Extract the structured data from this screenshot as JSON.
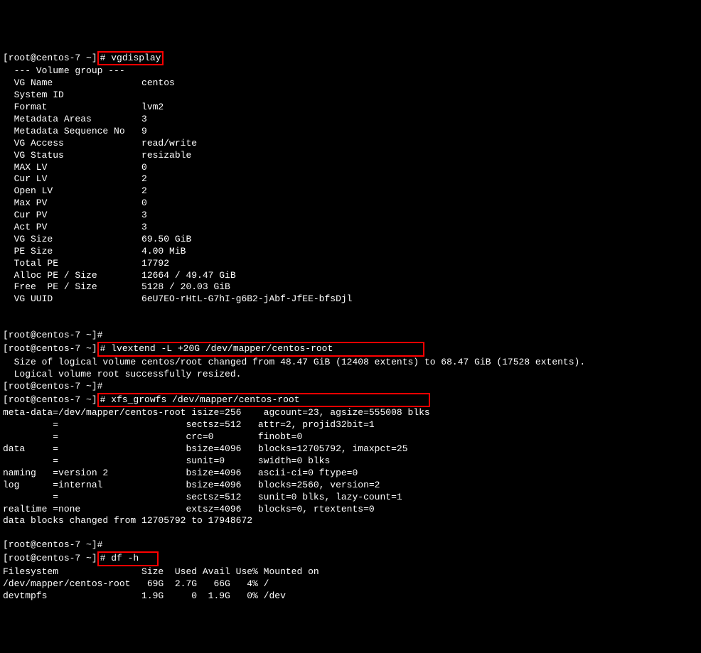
{
  "prompt1": "[root@centos-7 ~]",
  "cmd1_hash": "# ",
  "cmd1": "vgdisplay",
  "vg": {
    "header": "  --- Volume group ---",
    "rows": [
      [
        "  VG Name",
        "centos"
      ],
      [
        "  System ID",
        ""
      ],
      [
        "  Format",
        "lvm2"
      ],
      [
        "  Metadata Areas",
        "3"
      ],
      [
        "  Metadata Sequence No",
        "9"
      ],
      [
        "  VG Access",
        "read/write"
      ],
      [
        "  VG Status",
        "resizable"
      ],
      [
        "  MAX LV",
        "0"
      ],
      [
        "  Cur LV",
        "2"
      ],
      [
        "  Open LV",
        "2"
      ],
      [
        "  Max PV",
        "0"
      ],
      [
        "  Cur PV",
        "3"
      ],
      [
        "  Act PV",
        "3"
      ],
      [
        "  VG Size",
        "69.50 GiB"
      ],
      [
        "  PE Size",
        "4.00 MiB"
      ],
      [
        "  Total PE",
        "17792"
      ],
      [
        "  Alloc PE / Size",
        "12664 / 49.47 GiB"
      ],
      [
        "  Free  PE / Size",
        "5128 / 20.03 GiB"
      ],
      [
        "  VG UUID",
        "6eU7EO-rHtL-G7hI-g6B2-jAbf-JfEE-bfsDjl"
      ]
    ]
  },
  "blank1": "",
  "prompt2": "[root@centos-7 ~]# ",
  "prompt3a": "[root@centos-7 ~]",
  "cmd3": "# lvextend -L +20G /dev/mapper/centos-root",
  "pad3": "                ",
  "lvout1": "  Size of logical volume centos/root changed from 48.47 GiB (12408 extents) to 68.47 GiB (17528 extents).",
  "lvout2": "  Logical volume root successfully resized.",
  "prompt4": "[root@centos-7 ~]# ",
  "prompt5a": "[root@centos-7 ~]",
  "cmd5": "# xfs_growfs /dev/mapper/centos-root",
  "pad5": "                       ",
  "xfs": [
    "meta-data=/dev/mapper/centos-root isize=256    agcount=23, agsize=555008 blks",
    "         =                       sectsz=512   attr=2, projid32bit=1",
    "         =                       crc=0        finobt=0",
    "data     =                       bsize=4096   blocks=12705792, imaxpct=25",
    "         =                       sunit=0      swidth=0 blks",
    "naming   =version 2              bsize=4096   ascii-ci=0 ftype=0",
    "log      =internal               bsize=4096   blocks=2560, version=2",
    "         =                       sectsz=512   sunit=0 blks, lazy-count=1",
    "realtime =none                   extsz=4096   blocks=0, rtextents=0",
    "data blocks changed from 12705792 to 17948672"
  ],
  "prompt6": "[root@centos-7 ~]# ",
  "prompt7a": "[root@centos-7 ~]",
  "cmd7": "# df -h",
  "pad7": "   ",
  "df": [
    "Filesystem               Size  Used Avail Use% Mounted on",
    "/dev/mapper/centos-root   69G  2.7G   66G   4% /",
    "devtmpfs                 1.9G     0  1.9G   0% /dev"
  ]
}
